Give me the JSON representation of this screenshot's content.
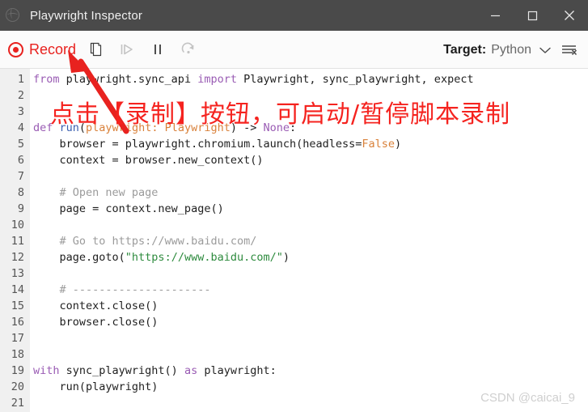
{
  "window": {
    "title": "Playwright Inspector",
    "app_icon": "globe-icon",
    "controls": {
      "minimize": "minimize-icon",
      "maximize": "maximize-icon",
      "close": "close-icon"
    }
  },
  "toolbar": {
    "record_label": "Record",
    "record_icon": "record-circle-icon",
    "copy_icon": "copy-icon",
    "step_over_icon": "step-over-icon",
    "pause_icon": "pause-icon",
    "resume_icon": "resume-icon",
    "target_label": "Target:",
    "target_value": "Python",
    "chevron_icon": "chevron-down-icon",
    "clear_icon": "clear-list-icon",
    "accent_color": "#e8221f"
  },
  "editor": {
    "lines": [
      {
        "n": "1",
        "tokens": [
          {
            "t": "from ",
            "c": "k"
          },
          {
            "t": "playwright.sync_api ",
            "c": ""
          },
          {
            "t": "import ",
            "c": "k"
          },
          {
            "t": "Playwright, sync_playwright, expect",
            "c": ""
          }
        ]
      },
      {
        "n": "2",
        "tokens": []
      },
      {
        "n": "3",
        "tokens": []
      },
      {
        "n": "4",
        "tokens": [
          {
            "t": "def ",
            "c": "k"
          },
          {
            "t": "run",
            "c": "fn"
          },
          {
            "t": "(",
            "c": ""
          },
          {
            "t": "playwright: Playwright",
            "c": "pa"
          },
          {
            "t": ") -> ",
            "c": ""
          },
          {
            "t": "None",
            "c": "cn"
          },
          {
            "t": ":",
            "c": ""
          }
        ]
      },
      {
        "n": "5",
        "tokens": [
          {
            "t": "    browser = playwright.chromium.launch(headless=",
            "c": ""
          },
          {
            "t": "False",
            "c": "pa"
          },
          {
            "t": ")",
            "c": ""
          }
        ]
      },
      {
        "n": "6",
        "tokens": [
          {
            "t": "    context = browser.new_context()",
            "c": ""
          }
        ]
      },
      {
        "n": "7",
        "tokens": []
      },
      {
        "n": "8",
        "tokens": [
          {
            "t": "    # Open new page",
            "c": "cm"
          }
        ]
      },
      {
        "n": "9",
        "tokens": [
          {
            "t": "    page = context.new_page()",
            "c": ""
          }
        ]
      },
      {
        "n": "10",
        "tokens": []
      },
      {
        "n": "11",
        "tokens": [
          {
            "t": "    # Go to https://www.baidu.com/",
            "c": "cm"
          }
        ]
      },
      {
        "n": "12",
        "tokens": [
          {
            "t": "    page.goto(",
            "c": ""
          },
          {
            "t": "\"https://www.baidu.com/\"",
            "c": "st"
          },
          {
            "t": ")",
            "c": ""
          }
        ]
      },
      {
        "n": "13",
        "tokens": []
      },
      {
        "n": "14",
        "tokens": [
          {
            "t": "    # ---------------------",
            "c": "cm"
          }
        ]
      },
      {
        "n": "15",
        "tokens": [
          {
            "t": "    context.close()",
            "c": ""
          }
        ]
      },
      {
        "n": "16",
        "tokens": [
          {
            "t": "    browser.close()",
            "c": ""
          }
        ]
      },
      {
        "n": "17",
        "tokens": []
      },
      {
        "n": "18",
        "tokens": []
      },
      {
        "n": "19",
        "tokens": [
          {
            "t": "with ",
            "c": "k"
          },
          {
            "t": "sync_playwright() ",
            "c": ""
          },
          {
            "t": "as ",
            "c": "k"
          },
          {
            "t": "playwright:",
            "c": ""
          }
        ]
      },
      {
        "n": "20",
        "tokens": [
          {
            "t": "    run(playwright)",
            "c": ""
          }
        ]
      },
      {
        "n": "21",
        "tokens": []
      }
    ]
  },
  "annotation": {
    "text": "点击【录制】按钮，可启动/暂停脚本录制",
    "color": "#f5231f",
    "arrow": "red-arrow-pointing-to-record-button"
  },
  "watermark": {
    "text": "CSDN @caicai_9"
  }
}
